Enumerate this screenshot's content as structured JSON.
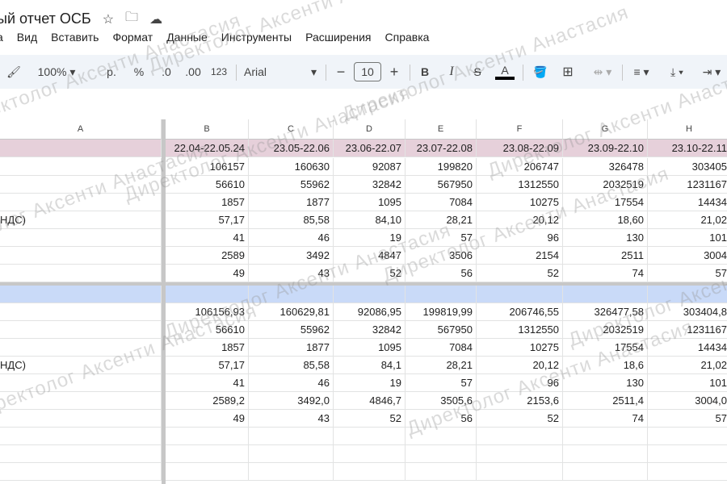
{
  "title": "ый отчет ОСБ",
  "menu": [
    "а",
    "Вид",
    "Вставить",
    "Формат",
    "Данные",
    "Инструменты",
    "Расширения",
    "Справка"
  ],
  "toolbar": {
    "zoom": "100%",
    "currency": "р.",
    "percent": "%",
    "dec_less": ".0",
    "dec_more": ".00",
    "format123": "123",
    "font": "Arial",
    "font_size": "10",
    "bold": "B",
    "italic": "I",
    "text_color": "A"
  },
  "columns": [
    "A",
    "B",
    "C",
    "D",
    "E",
    "F",
    "G",
    "H"
  ],
  "header_row": [
    "",
    "22.04-22.05.24",
    "23.05-22.06",
    "23.06-22.07",
    "23.07-22.08",
    "23.08-22.09",
    "23.09-22.10",
    "23.10-22.11"
  ],
  "block1": [
    [
      "",
      "106157",
      "160630",
      "92087",
      "199820",
      "206747",
      "326478",
      "303405"
    ],
    [
      "",
      "56610",
      "55962",
      "32842",
      "567950",
      "1312550",
      "2032519",
      "1231167"
    ],
    [
      "",
      "1857",
      "1877",
      "1095",
      "7084",
      "10275",
      "17554",
      "14434"
    ],
    [
      "НДС)",
      "57,17",
      "85,58",
      "84,10",
      "28,21",
      "20,12",
      "18,60",
      "21,02"
    ],
    [
      "",
      "41",
      "46",
      "19",
      "57",
      "96",
      "130",
      "101"
    ],
    [
      "",
      "2589",
      "3492",
      "4847",
      "3506",
      "2154",
      "2511",
      "3004"
    ],
    [
      "",
      "49",
      "43",
      "52",
      "56",
      "52",
      "74",
      "57"
    ]
  ],
  "block2": [
    [
      "",
      "106156,93",
      "160629,81",
      "92086,95",
      "199819,99",
      "206746,55",
      "326477,58",
      "303404,8"
    ],
    [
      "",
      "56610",
      "55962",
      "32842",
      "567950",
      "1312550",
      "2032519",
      "1231167"
    ],
    [
      "",
      "1857",
      "1877",
      "1095",
      "7084",
      "10275",
      "17554",
      "14434"
    ],
    [
      "НДС)",
      "57,17",
      "85,58",
      "84,1",
      "28,21",
      "20,12",
      "18,6",
      "21,02"
    ],
    [
      "",
      "41",
      "46",
      "19",
      "57",
      "96",
      "130",
      "101"
    ],
    [
      "",
      "2589,2",
      "3492,0",
      "4846,7",
      "3505,6",
      "2153,6",
      "2511,4",
      "3004,0"
    ],
    [
      "",
      "49",
      "43",
      "52",
      "56",
      "52",
      "74",
      "57"
    ]
  ],
  "colors": {
    "header_row": "#e6d0da",
    "blue_row": "#c9daf8",
    "toolbar_bg": "#f0f4f9"
  },
  "watermark": "Директолог Аксенти Анастасия"
}
